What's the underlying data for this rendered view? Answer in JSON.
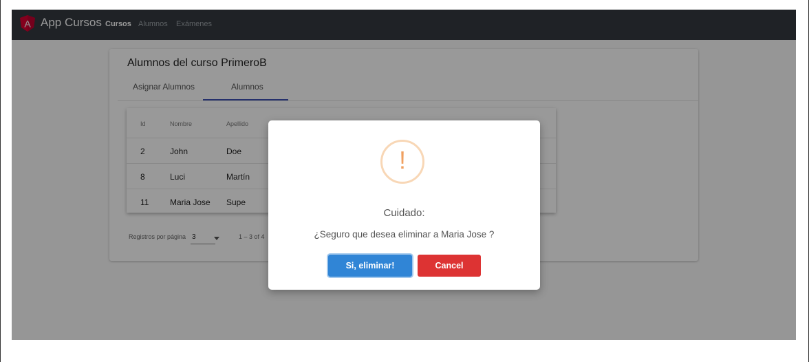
{
  "navbar": {
    "brand": "App Cursos",
    "links": [
      "Cursos",
      "Alumnos",
      "Exámenes"
    ]
  },
  "card": {
    "title": "Alumnos del curso PrimeroB",
    "tabs": [
      "Asignar Alumnos",
      "Alumnos"
    ],
    "active_tab": "Alumnos"
  },
  "table": {
    "headers": [
      "Id",
      "Nombre",
      "Apellido"
    ],
    "rows": [
      {
        "id": "2",
        "nombre": "John",
        "apellido": "Doe"
      },
      {
        "id": "8",
        "nombre": "Luci",
        "apellido": "Martín"
      },
      {
        "id": "11",
        "nombre": "Maria Jose",
        "apellido": "Supe"
      }
    ]
  },
  "paginator": {
    "label": "Registros por página",
    "page_size": "3",
    "range": "1 – 3 of 4"
  },
  "dialog": {
    "icon": "warning-icon",
    "title": "Cuidado:",
    "text": "¿Seguro que desea eliminar a Maria Jose ?",
    "confirm_label": "Si, eliminar!",
    "cancel_label": "Cancel"
  },
  "colors": {
    "navbar_bg": "#343a40",
    "confirm": "#3085d6",
    "cancel": "#dd3333",
    "warning": "#f8bb86",
    "tab_accent": "#3f51b5"
  }
}
